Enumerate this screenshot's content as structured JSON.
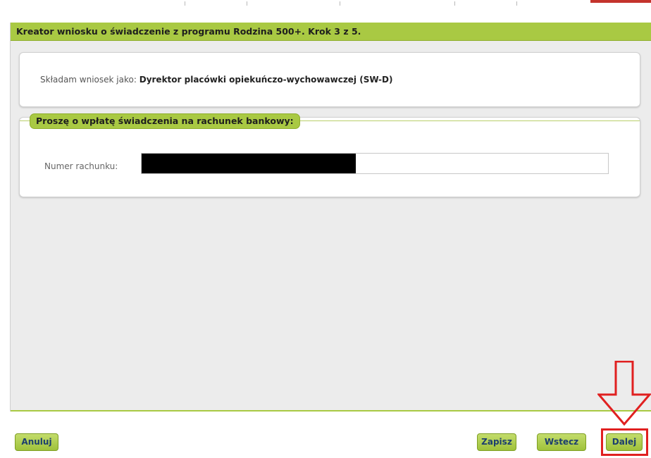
{
  "wizard": {
    "title": "Kreator wniosku o świadczenie z programu Rodzina 500+. Krok 3 z 5."
  },
  "applicant": {
    "label": "Składam wniosek jako:",
    "value": "Dyrektor placówki opiekuńczo-wychowawczej (SW-D)"
  },
  "bank_section": {
    "legend": "Proszę o wpłatę świadczenia na rachunek bankowy:",
    "account_label": "Numer rachunku:",
    "account_value_redacted": true
  },
  "buttons": {
    "cancel": "Anuluj",
    "save": "Zapisz",
    "back": "Wstecz",
    "next": "Dalej"
  },
  "annotation": {
    "highlight_color": "#e02020",
    "arrow": "arrow-down-icon"
  },
  "colors": {
    "accent_green": "#a9c943",
    "panel_bg": "#ececec",
    "button_text": "#1c3e6e"
  }
}
